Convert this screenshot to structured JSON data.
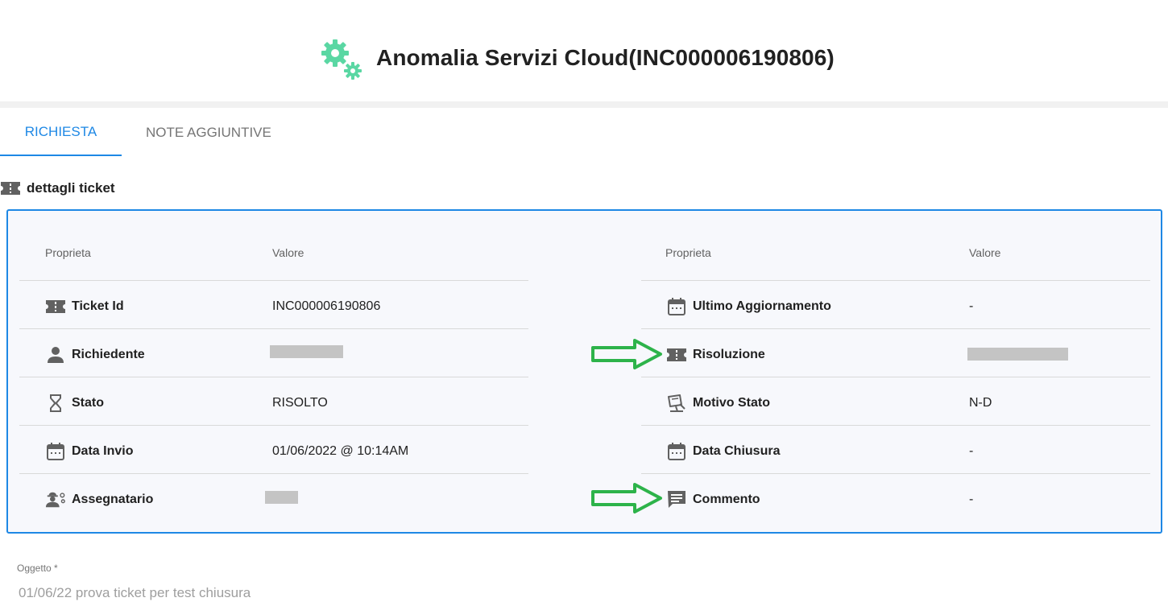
{
  "header": {
    "title": "Anomalia Servizi Cloud(INC000006190806)",
    "icon": "gears-icon",
    "icon_color": "#5ad7a3"
  },
  "tabs": [
    {
      "label": "RICHIESTA",
      "active": true
    },
    {
      "label": "NOTE AGGIUNTIVE",
      "active": false
    }
  ],
  "section": {
    "title": "dettagli ticket",
    "icon": "ticket-icon"
  },
  "table_left": {
    "col_prop": "Proprieta",
    "col_val": "Valore",
    "rows": [
      {
        "icon": "ticket-icon",
        "label": "Ticket Id",
        "value": "INC000006190806"
      },
      {
        "icon": "person-icon",
        "label": "Richiedente",
        "value": ""
      },
      {
        "icon": "hourglass-icon",
        "label": "Stato",
        "value": "RISOLTO"
      },
      {
        "icon": "calendar-icon",
        "label": "Data Invio",
        "value": "01/06/2022 @ 10:14AM"
      },
      {
        "icon": "engineer-icon",
        "label": "Assegnatario",
        "value": ""
      }
    ]
  },
  "table_right": {
    "col_prop": "Proprieta",
    "col_val": "Valore",
    "rows": [
      {
        "icon": "calendar-icon",
        "label": "Ultimo Aggiornamento",
        "value": "-"
      },
      {
        "icon": "ticket-icon",
        "label": "Risoluzione",
        "value": ""
      },
      {
        "icon": "sign-icon",
        "label": "Motivo Stato",
        "value": "N-D"
      },
      {
        "icon": "calendar-icon",
        "label": "Data Chiusura",
        "value": "-"
      },
      {
        "icon": "comment-icon",
        "label": "Commento",
        "value": "-"
      }
    ]
  },
  "form": {
    "oggetto_label": "Oggetto *",
    "oggetto_value": "01/06/22 prova ticket per test chiusura"
  },
  "colors": {
    "accent": "#1e88e5",
    "panel_bg": "#f7f8fc",
    "annotation_arrow": "#2db34a",
    "icon_gray": "#616161"
  }
}
